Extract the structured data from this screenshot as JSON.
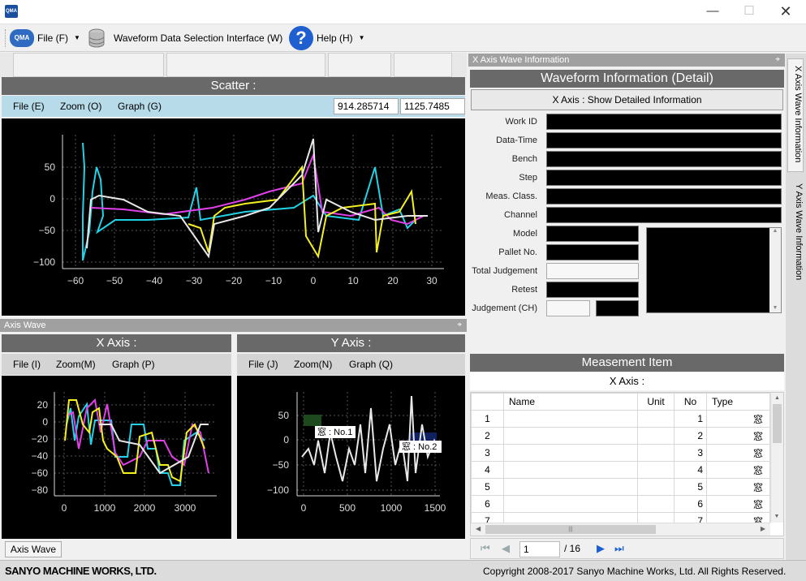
{
  "menu": {
    "file": "File (F)",
    "waveform_selection": "Waveform Data Selection Interface (W)",
    "help": "Help (H)"
  },
  "scatter": {
    "title": "Scatter :",
    "toolbar": {
      "file": "File (E)",
      "zoom": "Zoom (O)",
      "graph": "Graph (G)"
    },
    "coord_x": "914.285714",
    "coord_y": "1125.7485",
    "x_ticks": [
      "−60",
      "−50",
      "−40",
      "−30",
      "−20",
      "−10",
      "0",
      "10",
      "20",
      "30"
    ],
    "y_ticks": [
      "50",
      "0",
      "−50",
      "−100"
    ]
  },
  "axis_wave": {
    "panel_title": "Axis Wave",
    "x_axis": {
      "title": "X Axis :",
      "toolbar": {
        "file": "File (I)",
        "zoom": "Zoom(M)",
        "graph": "Graph (P)"
      },
      "x_ticks": [
        "0",
        "1000",
        "2000",
        "3000"
      ],
      "y_ticks": [
        "20",
        "0",
        "−20",
        "−40",
        "−60",
        "−80"
      ]
    },
    "y_axis": {
      "title": "Y Axis :",
      "toolbar": {
        "file": "File (J)",
        "zoom": "Zoom(N)",
        "graph": "Graph (Q)"
      },
      "x_ticks": [
        "0",
        "500",
        "1000",
        "1500"
      ],
      "y_ticks": [
        "50",
        "0",
        "−50",
        "−100"
      ],
      "annotations": [
        "窓 : No.1",
        "窓 : No.2"
      ]
    },
    "bottom_tab": "Axis Wave"
  },
  "x_wave_info": {
    "panel_title": "X Axis Wave Information",
    "header": "Waveform Information (Detail)",
    "show_button": "X Axis : Show Detailed Information",
    "fields": [
      "Work ID",
      "Data-Time",
      "Bench",
      "Step",
      "Meas. Class.",
      "Channel",
      "Model",
      "Pallet No.",
      "Total Judgement",
      "Retest",
      "Judgement (CH)"
    ]
  },
  "measurement": {
    "header": "Measement Item",
    "sub_header": "X Axis :",
    "columns": [
      "Name",
      "Unit",
      "No",
      "Type"
    ],
    "rows": [
      {
        "idx": "1",
        "no": "1",
        "type": "窓"
      },
      {
        "idx": "2",
        "no": "2",
        "type": "窓"
      },
      {
        "idx": "3",
        "no": "3",
        "type": "窓"
      },
      {
        "idx": "4",
        "no": "4",
        "type": "窓"
      },
      {
        "idx": "5",
        "no": "5",
        "type": "窓"
      },
      {
        "idx": "6",
        "no": "6",
        "type": "窓"
      },
      {
        "idx": "7",
        "no": "7",
        "type": "窓"
      }
    ],
    "pager": {
      "current": "1",
      "total": "/ 16"
    }
  },
  "side_tabs": {
    "x": "X Axis Wave Information",
    "y": "Y Axis Wave Information"
  },
  "status": {
    "company": "SANYO MACHINE WORKS, LTD.",
    "copyright": "Copyright 2008-2017 Sanyo Machine Works, Ltd. All Rights Reserved."
  },
  "colors": {
    "cyan": "#22d3e8",
    "magenta": "#e040e8",
    "yellow": "#f5f020",
    "white": "#e8e8e8"
  }
}
